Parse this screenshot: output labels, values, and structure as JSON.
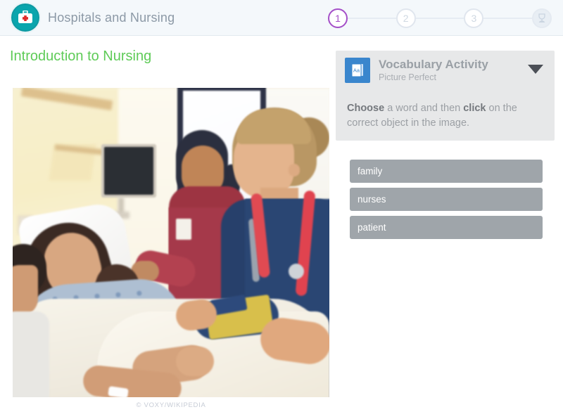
{
  "header": {
    "brand_icon": "medical-bag-icon",
    "title": "Hospitals and Nursing",
    "steps": [
      {
        "label": "1",
        "state": "active"
      },
      {
        "label": "2",
        "state": "idle"
      },
      {
        "label": "3",
        "state": "idle"
      },
      {
        "label": "",
        "state": "trophy",
        "icon": "trophy-icon"
      }
    ],
    "colors": {
      "active_step": "#a44fc8",
      "idle_step": "#cfd8e2",
      "brand_teal": "#0aa5ad",
      "background": "#f4f8fb"
    }
  },
  "lesson": {
    "title": "Introduction to Nursing",
    "title_color": "#5ecb57",
    "photo_alt": "Two nurses speaking with a smiling patient in a hospital bed",
    "photo_credit": "© VOXY/WIKIPEDIA"
  },
  "activity": {
    "icon": "vocabulary-card-icon",
    "icon_label": "Aa",
    "title": "Vocabulary Activity",
    "subtitle": "Picture Perfect",
    "caret": "chevron-down-icon",
    "instruction": {
      "part1_bold": "Choose",
      "part2": " a word and then ",
      "part3_bold": "click",
      "part4": " on the correct object in the image."
    },
    "panel_color": "#e7e8e9",
    "icon_color": "#3a86cd"
  },
  "words": {
    "button_color": "#9fa5aa",
    "items": [
      {
        "label": "family"
      },
      {
        "label": "nurses"
      },
      {
        "label": "patient"
      }
    ]
  }
}
